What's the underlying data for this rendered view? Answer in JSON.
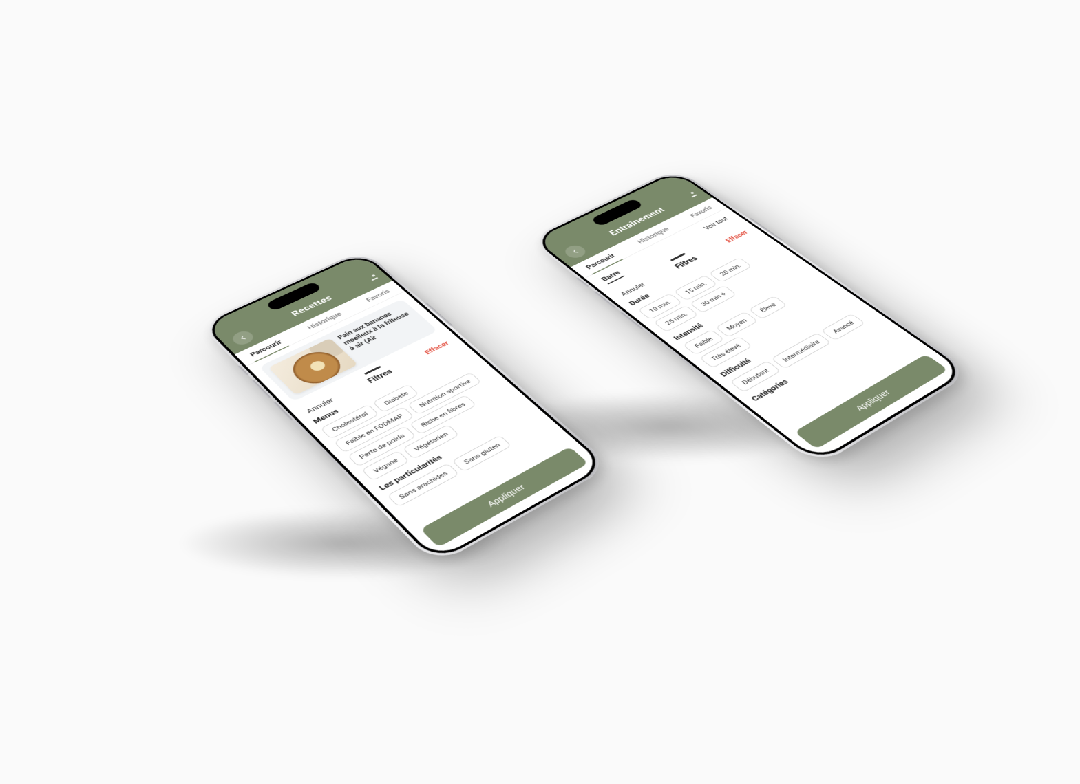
{
  "colors": {
    "accent": "#7a8a6a",
    "danger": "#e24a3a"
  },
  "common": {
    "tabs": {
      "browse": "Parcourir",
      "history": "Historique",
      "favorites": "Favoris"
    },
    "sheet": {
      "cancel": "Annuler",
      "title": "Filtres",
      "clear": "Effacer",
      "apply": "Appliquer"
    }
  },
  "phone1": {
    "title": "Recettes",
    "active_tab": "browse",
    "card": {
      "title": "Pain aux bananes moelleux à la friteuse à air (Air"
    },
    "groups": [
      {
        "title": "Menus",
        "options": [
          "Cholestérol",
          "Diabète",
          "Faible en FODMAP",
          "Nutrition sportive",
          "Perte de poids",
          "Riche en fibres",
          "Végane",
          "Végétarien"
        ]
      },
      {
        "title": "Les particularités",
        "options": [
          "Sans arachides",
          "Sans gluten"
        ]
      }
    ]
  },
  "phone2": {
    "title": "Entraînement",
    "active_tab": "browse",
    "category": {
      "selected": "Barre",
      "view_all": "Voir tout"
    },
    "groups": [
      {
        "title": "Durée",
        "options": [
          "10 min.",
          "15 min.",
          "20 min.",
          "25 min.",
          "30 min +"
        ]
      },
      {
        "title": "Intensité",
        "options": [
          "Faible",
          "Moyen",
          "Élevé",
          "Très élevé"
        ]
      },
      {
        "title": "Difficulté",
        "options": [
          "Débutant",
          "Intermédiaire",
          "Avancé"
        ]
      },
      {
        "title": "Catégories",
        "options": []
      }
    ]
  }
}
